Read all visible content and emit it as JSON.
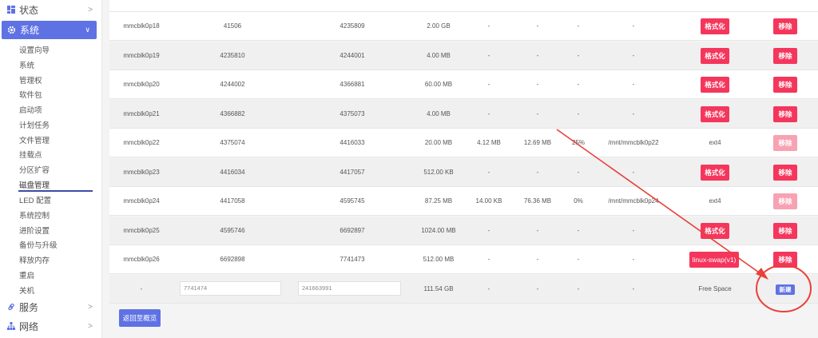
{
  "sidebar": {
    "status_label": "状态",
    "system_label": "系统",
    "submenu": [
      "设置向导",
      "系统",
      "管理权",
      "软件包",
      "启动项",
      "计划任务",
      "文件管理",
      "挂载点",
      "分区扩容",
      "磁盘管理",
      "LED 配置",
      "系统控制",
      "进阶设置",
      "备份与升级",
      "释放内存",
      "重启",
      "关机"
    ],
    "active_index": 9,
    "services_label": "服务",
    "network_label": "网络"
  },
  "colors": {
    "accent": "#5e72e4",
    "danger": "#f5365c",
    "annotation": "#e8403a"
  },
  "partitions": [
    {
      "name": "mmcblk0p18",
      "start": "41506",
      "end": "4235809",
      "size": "2.00 GB",
      "used": "-",
      "free": "-",
      "pct": "-",
      "mount": "-",
      "fs_label": "格式化",
      "fs_type": "button",
      "remove_label": "移除",
      "remove_disabled": false
    },
    {
      "name": "mmcblk0p19",
      "start": "4235810",
      "end": "4244001",
      "size": "4.00 MB",
      "used": "-",
      "free": "-",
      "pct": "-",
      "mount": "-",
      "fs_label": "格式化",
      "fs_type": "button",
      "remove_label": "移除",
      "remove_disabled": false
    },
    {
      "name": "mmcblk0p20",
      "start": "4244002",
      "end": "4366881",
      "size": "60.00 MB",
      "used": "-",
      "free": "-",
      "pct": "-",
      "mount": "-",
      "fs_label": "格式化",
      "fs_type": "button",
      "remove_label": "移除",
      "remove_disabled": false
    },
    {
      "name": "mmcblk0p21",
      "start": "4366882",
      "end": "4375073",
      "size": "4.00 MB",
      "used": "-",
      "free": "-",
      "pct": "-",
      "mount": "-",
      "fs_label": "格式化",
      "fs_type": "button",
      "remove_label": "移除",
      "remove_disabled": false
    },
    {
      "name": "mmcblk0p22",
      "start": "4375074",
      "end": "4416033",
      "size": "20.00 MB",
      "used": "4.12 MB",
      "free": "12.69 MB",
      "pct": "25%",
      "mount": "/mnt/mmcblk0p22",
      "fs_label": "ext4",
      "fs_type": "text",
      "remove_label": "移除",
      "remove_disabled": true
    },
    {
      "name": "mmcblk0p23",
      "start": "4416034",
      "end": "4417057",
      "size": "512.00 KB",
      "used": "-",
      "free": "-",
      "pct": "-",
      "mount": "-",
      "fs_label": "格式化",
      "fs_type": "button",
      "remove_label": "移除",
      "remove_disabled": false
    },
    {
      "name": "mmcblk0p24",
      "start": "4417058",
      "end": "4595745",
      "size": "87.25 MB",
      "used": "14.00 KB",
      "free": "76.36 MB",
      "pct": "0%",
      "mount": "/mnt/mmcblk0p24",
      "fs_label": "ext4",
      "fs_type": "text",
      "remove_label": "移除",
      "remove_disabled": true
    },
    {
      "name": "mmcblk0p25",
      "start": "4595746",
      "end": "6692897",
      "size": "1024.00 MB",
      "used": "-",
      "free": "-",
      "pct": "-",
      "mount": "-",
      "fs_label": "格式化",
      "fs_type": "button",
      "remove_label": "移除",
      "remove_disabled": false
    },
    {
      "name": "mmcblk0p26",
      "start": "6692898",
      "end": "7741473",
      "size": "512.00 MB",
      "used": "-",
      "free": "-",
      "pct": "-",
      "mount": "-",
      "fs_label": "linux-swap(v1)",
      "fs_type": "swap",
      "remove_label": "移除",
      "remove_disabled": false
    }
  ],
  "free_row": {
    "name": "-",
    "start_placeholder": "7741474",
    "end_placeholder": "241663991",
    "size": "111.54 GB",
    "used": "-",
    "free": "-",
    "pct": "-",
    "mount": "-",
    "fs_label": "Free Space",
    "new_label": "新建"
  },
  "back_button_label": "返回至概览"
}
